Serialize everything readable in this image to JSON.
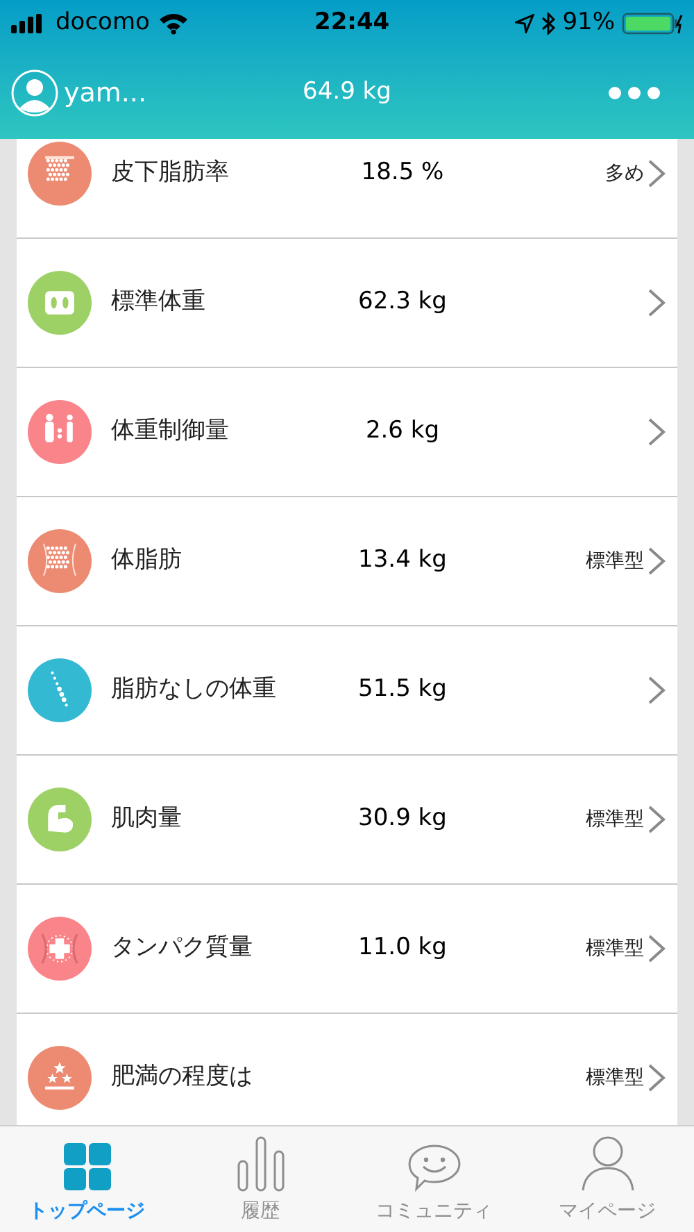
{
  "status_bar": {
    "carrier": "docomo",
    "time": "22:44",
    "battery": "91%"
  },
  "header": {
    "user": "yam...",
    "weight": "64.9 kg"
  },
  "metrics": [
    {
      "kind": "fat-rate",
      "color": "#ec8a72",
      "label": "皮下脂肪率",
      "value": "18.5 %",
      "tag": "多め"
    },
    {
      "kind": "scale",
      "color": "#9dd166",
      "label": "標準体重",
      "value": "62.3 kg"
    },
    {
      "kind": "figures",
      "color": "#f9848a",
      "label": "体重制御量",
      "value": "2.6 kg"
    },
    {
      "kind": "fat-mass",
      "color": "#ec8a72",
      "label": "体脂肪",
      "value": "13.4 kg",
      "tag": "標準型"
    },
    {
      "kind": "spine",
      "color": "#34b9d3",
      "label": "脂肪なしの体重",
      "value": "51.5 kg"
    },
    {
      "kind": "muscle",
      "color": "#9dd166",
      "label": "肌肉量",
      "value": "30.9 kg",
      "tag": "標準型"
    },
    {
      "kind": "protein",
      "color": "#f9848a",
      "label": "タンパク質量",
      "value": "11.0 kg",
      "tag": "標準型"
    },
    {
      "kind": "stars",
      "color": "#ec8a72",
      "label": "肥満の程度は",
      "tag": "標準型"
    }
  ],
  "tabs": [
    {
      "kind": "grid",
      "label": "トップページ",
      "selected": true
    },
    {
      "kind": "bars",
      "label": "履歴",
      "selected": false
    },
    {
      "kind": "chat",
      "label": "コミュニティ",
      "selected": false
    },
    {
      "kind": "person",
      "label": "マイページ",
      "selected": false
    }
  ]
}
